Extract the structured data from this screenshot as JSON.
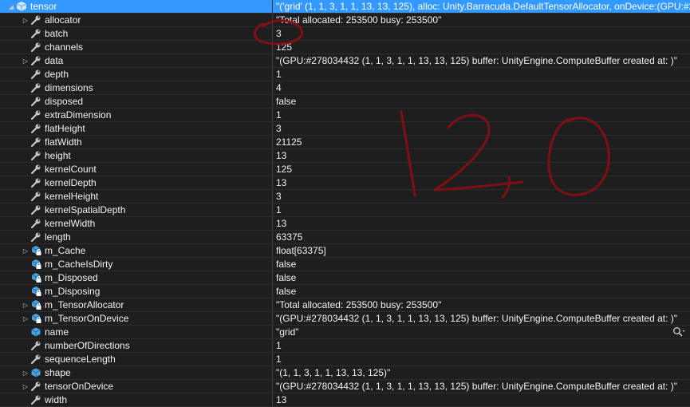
{
  "rows": [
    {
      "name": "tensor",
      "value": "\"('grid' (1, 1, 3, 1, 1, 13, 13, 125), alloc: Unity.Barracuda.DefaultTensorAllocator, onDevice:(GPU:#27...",
      "expander": "collapse",
      "icon": "object-icon",
      "selected": true,
      "depth": 0
    },
    {
      "name": "allocator",
      "value": "\"Total allocated: 253500 busy: 253500\"",
      "expander": "expand",
      "icon": "property-wrench-icon",
      "depth": 1
    },
    {
      "name": "batch",
      "value": "3",
      "expander": "none",
      "icon": "property-wrench-icon",
      "depth": 1
    },
    {
      "name": "channels",
      "value": "125",
      "expander": "none",
      "icon": "property-wrench-icon",
      "depth": 1
    },
    {
      "name": "data",
      "value": "\"(GPU:#278034432 (1, 1, 3, 1, 1, 13, 13, 125) buffer: UnityEngine.ComputeBuffer created at: )\"",
      "expander": "expand",
      "icon": "property-wrench-icon",
      "depth": 1
    },
    {
      "name": "depth",
      "value": "1",
      "expander": "none",
      "icon": "property-wrench-icon",
      "depth": 1
    },
    {
      "name": "dimensions",
      "value": "4",
      "expander": "none",
      "icon": "property-wrench-icon",
      "depth": 1
    },
    {
      "name": "disposed",
      "value": "false",
      "expander": "none",
      "icon": "property-wrench-icon",
      "depth": 1
    },
    {
      "name": "extraDimension",
      "value": "1",
      "expander": "none",
      "icon": "property-wrench-icon",
      "depth": 1
    },
    {
      "name": "flatHeight",
      "value": "3",
      "expander": "none",
      "icon": "property-wrench-icon",
      "depth": 1
    },
    {
      "name": "flatWidth",
      "value": "21125",
      "expander": "none",
      "icon": "property-wrench-icon",
      "depth": 1
    },
    {
      "name": "height",
      "value": "13",
      "expander": "none",
      "icon": "property-wrench-icon",
      "depth": 1
    },
    {
      "name": "kernelCount",
      "value": "125",
      "expander": "none",
      "icon": "property-wrench-icon",
      "depth": 1
    },
    {
      "name": "kernelDepth",
      "value": "13",
      "expander": "none",
      "icon": "property-wrench-icon",
      "depth": 1
    },
    {
      "name": "kernelHeight",
      "value": "3",
      "expander": "none",
      "icon": "property-wrench-icon",
      "depth": 1
    },
    {
      "name": "kernelSpatialDepth",
      "value": "1",
      "expander": "none",
      "icon": "property-wrench-icon",
      "depth": 1
    },
    {
      "name": "kernelWidth",
      "value": "13",
      "expander": "none",
      "icon": "property-wrench-icon",
      "depth": 1
    },
    {
      "name": "length",
      "value": "63375",
      "expander": "none",
      "icon": "property-wrench-icon",
      "depth": 1
    },
    {
      "name": "m_Cache",
      "value": "float[63375]",
      "expander": "expand",
      "icon": "private-field-icon",
      "depth": 1
    },
    {
      "name": "m_CacheIsDirty",
      "value": "false",
      "expander": "none",
      "icon": "private-field-icon",
      "depth": 1
    },
    {
      "name": "m_Disposed",
      "value": "false",
      "expander": "none",
      "icon": "private-field-icon",
      "depth": 1
    },
    {
      "name": "m_Disposing",
      "value": "false",
      "expander": "none",
      "icon": "private-field-icon",
      "depth": 1
    },
    {
      "name": "m_TensorAllocator",
      "value": "\"Total allocated: 253500 busy: 253500\"",
      "expander": "expand",
      "icon": "private-field-icon",
      "depth": 1
    },
    {
      "name": "m_TensorOnDevice",
      "value": "\"(GPU:#278034432 (1, 1, 3, 1, 1, 13, 13, 125) buffer: UnityEngine.ComputeBuffer created at: )\"",
      "expander": "expand",
      "icon": "private-field-icon",
      "depth": 1
    },
    {
      "name": "name",
      "value": "\"grid\"",
      "expander": "none",
      "icon": "field-icon",
      "depth": 1,
      "magnifier": true
    },
    {
      "name": "numberOfDirections",
      "value": "1",
      "expander": "none",
      "icon": "property-wrench-icon",
      "depth": 1
    },
    {
      "name": "sequenceLength",
      "value": "1",
      "expander": "none",
      "icon": "property-wrench-icon",
      "depth": 1
    },
    {
      "name": "shape",
      "value": "\"(1, 1, 3, 1, 1, 13, 13, 125)\"",
      "expander": "expand",
      "icon": "field-icon",
      "depth": 1
    },
    {
      "name": "tensorOnDevice",
      "value": "\"(GPU:#278034432 (1, 1, 3, 1, 1, 13, 13, 125) buffer: UnityEngine.ComputeBuffer created at: )\"",
      "expander": "expand",
      "icon": "property-wrench-icon",
      "depth": 1
    },
    {
      "name": "width",
      "value": "13",
      "expander": "none",
      "icon": "property-wrench-icon",
      "depth": 1
    }
  ],
  "annotation": {
    "text": "0 1,2,0",
    "color": "#8b0000"
  },
  "colors": {
    "selected": "#3399ff",
    "wrench": "#c8c8c8",
    "cube": "#4aa3e0",
    "lock": "#ffffff"
  }
}
